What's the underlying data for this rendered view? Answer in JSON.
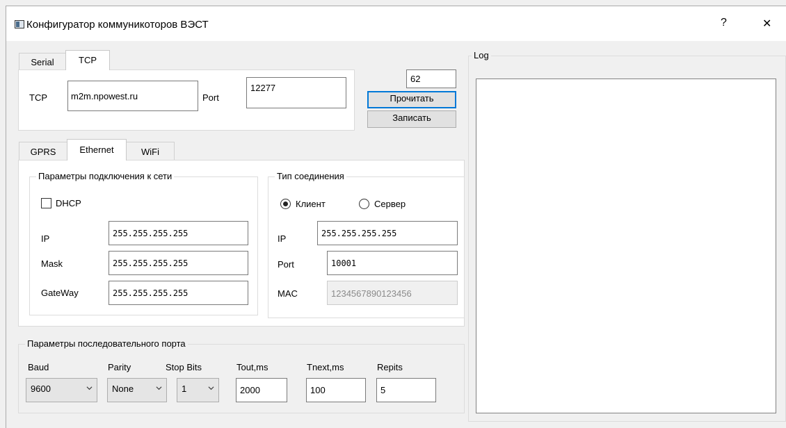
{
  "window": {
    "title": "Конфигуратор коммуникоторов ВЭСТ",
    "help_glyph": "?",
    "close_glyph": "✕"
  },
  "connection_tabs": {
    "items": [
      "Serial",
      "TCP"
    ],
    "active": "TCP"
  },
  "tcp": {
    "host_label": "TCP",
    "host_value": "m2m.npowest.ru",
    "port_label": "Port",
    "port_value": "12277"
  },
  "device": {
    "address_value": "62",
    "read_label": "Прочитать",
    "write_label": "Записать"
  },
  "network_tabs": {
    "items": [
      "GPRS",
      "Ethernet",
      "WiFi"
    ],
    "active": "Ethernet"
  },
  "network_params": {
    "title": "Параметры подключения к сети",
    "dhcp_label": "DHCP",
    "dhcp_checked": false,
    "ip_label": "IP",
    "ip_value": "255.255.255.255",
    "mask_label": "Mask",
    "mask_value": "255.255.255.255",
    "gateway_label": "GateWay",
    "gateway_value": "255.255.255.255"
  },
  "connection_type": {
    "title": "Тип соединения",
    "client_label": "Клиент",
    "server_label": "Сервер",
    "selected": "Клиент",
    "ip_label": "IP",
    "ip_value": "255.255.255.255",
    "port_label": "Port",
    "port_value": "10001",
    "mac_label": "MAC",
    "mac_value": "1234567890123456"
  },
  "serial_params": {
    "title": "Параметры последовательного порта",
    "baud_label": "Baud",
    "baud_value": "9600",
    "parity_label": "Parity",
    "parity_value": "None",
    "stopbits_label": "Stop Bits",
    "stopbits_value": "1",
    "tout_label": "Tout,ms",
    "tout_value": "2000",
    "tnext_label": "Tnext,ms",
    "tnext_value": "100",
    "repits_label": "Repits",
    "repits_value": "5"
  },
  "log": {
    "title": "Log",
    "content": ""
  }
}
